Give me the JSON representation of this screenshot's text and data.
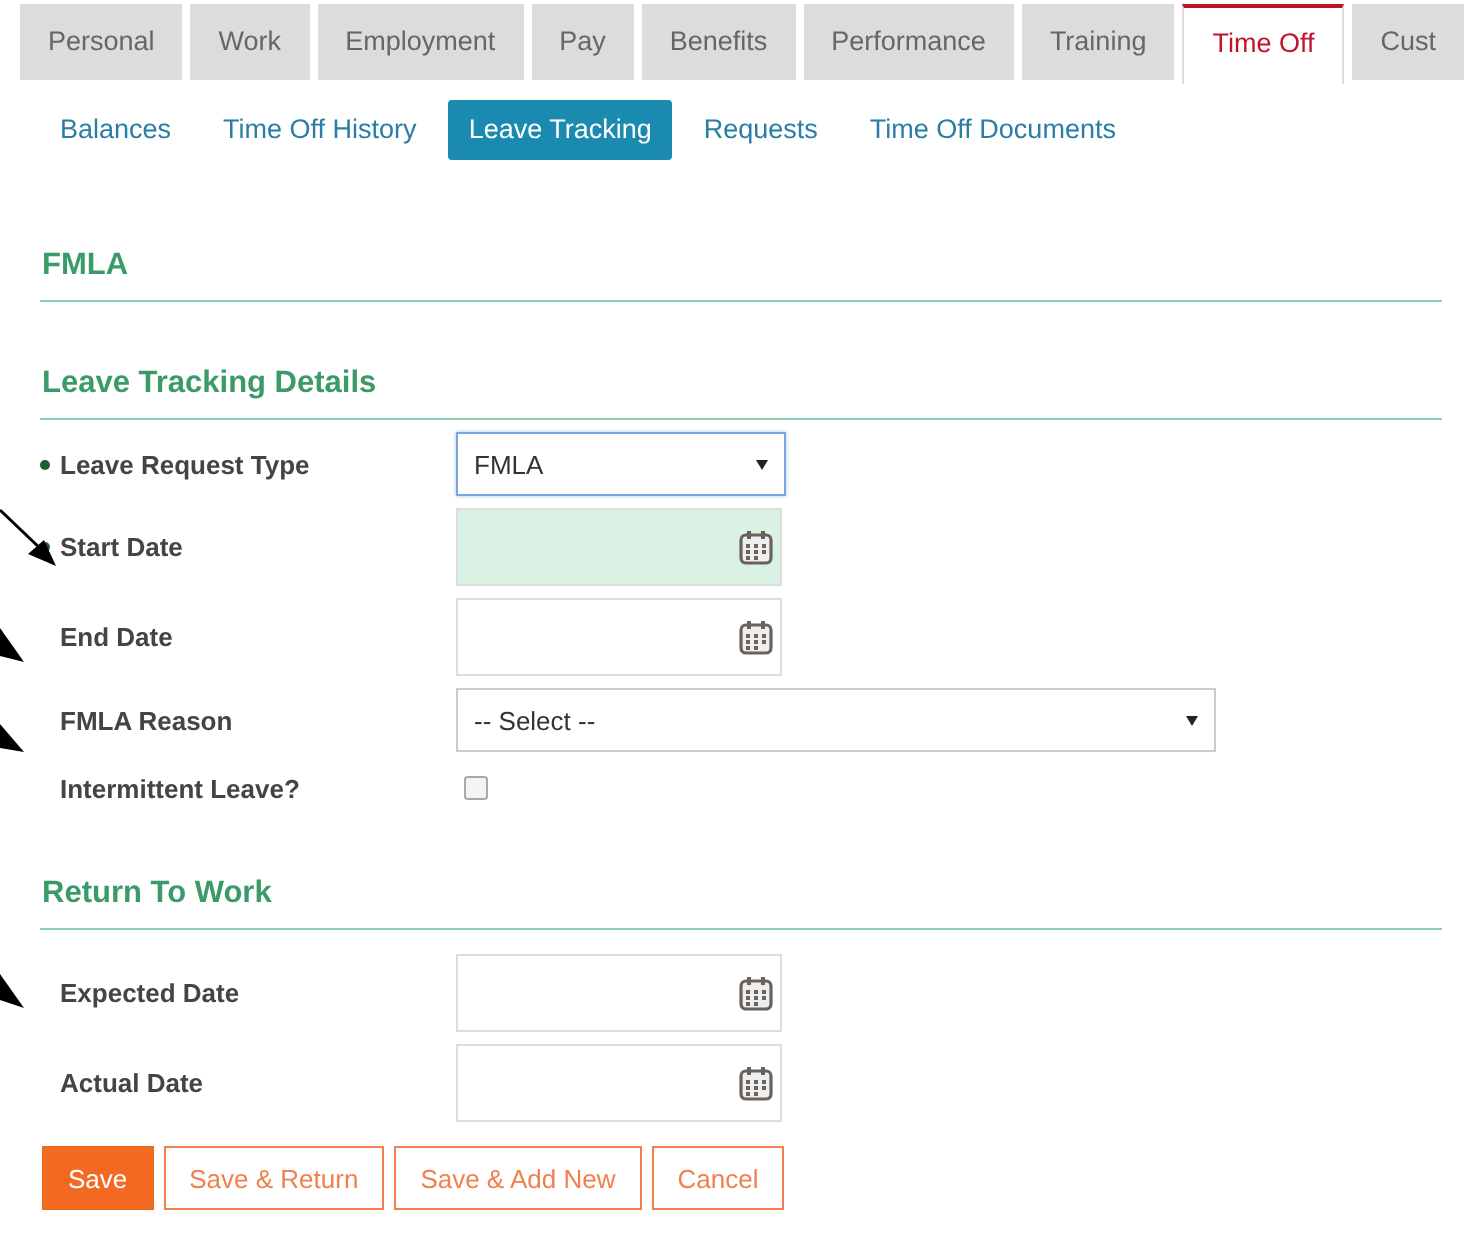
{
  "tabs": [
    {
      "label": "Personal",
      "selected": false
    },
    {
      "label": "Work",
      "selected": false
    },
    {
      "label": "Employment",
      "selected": false
    },
    {
      "label": "Pay",
      "selected": false
    },
    {
      "label": "Benefits",
      "selected": false
    },
    {
      "label": "Performance",
      "selected": false
    },
    {
      "label": "Training",
      "selected": false
    },
    {
      "label": "Time Off",
      "selected": true
    },
    {
      "label": "Cust",
      "selected": false
    }
  ],
  "subtabs": [
    {
      "label": "Balances",
      "selected": false
    },
    {
      "label": "Time Off History",
      "selected": false
    },
    {
      "label": "Leave Tracking",
      "selected": true
    },
    {
      "label": "Requests",
      "selected": false
    },
    {
      "label": "Time Off Documents",
      "selected": false
    }
  ],
  "sections": [
    {
      "title": "FMLA"
    },
    {
      "title": "Leave Tracking Details",
      "fields": [
        {
          "kind": "select",
          "label": "Leave Request Type",
          "required": true,
          "value": "FMLA",
          "focused": true,
          "wide": false
        },
        {
          "kind": "date",
          "label": "Start Date",
          "required": true,
          "highlighted": true
        },
        {
          "kind": "date",
          "label": "End Date",
          "required": false,
          "highlighted": false
        },
        {
          "kind": "select",
          "label": "FMLA Reason",
          "required": false,
          "value": "-- Select --",
          "focused": false,
          "wide": true
        },
        {
          "kind": "checkbox",
          "label": "Intermittent Leave?",
          "required": false,
          "checked": false
        }
      ]
    },
    {
      "title": "Return To Work",
      "fields": [
        {
          "kind": "date",
          "label": "Expected Date",
          "required": false,
          "highlighted": false
        },
        {
          "kind": "date",
          "label": "Actual Date",
          "required": false,
          "highlighted": false
        }
      ]
    }
  ],
  "buttons": [
    {
      "label": "Save",
      "primary": true
    },
    {
      "label": "Save & Return",
      "primary": false
    },
    {
      "label": "Save & Add New",
      "primary": false
    },
    {
      "label": "Cancel",
      "primary": false
    }
  ]
}
